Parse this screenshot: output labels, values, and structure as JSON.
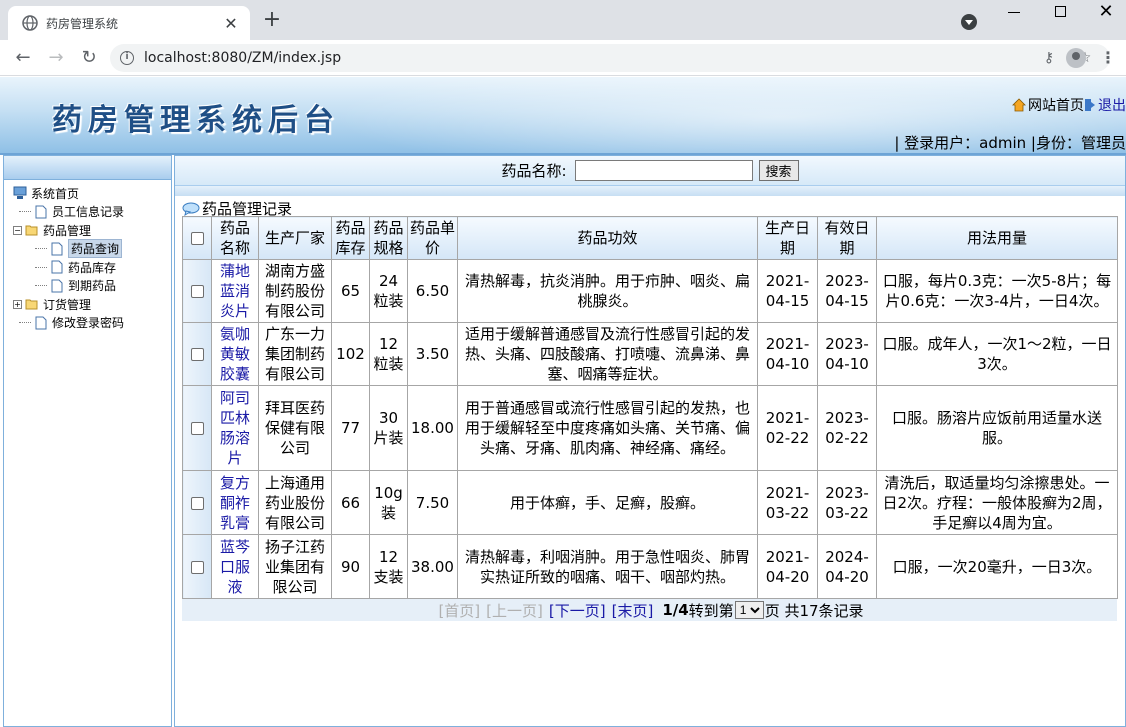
{
  "browser": {
    "tab_title": "药房管理系统",
    "url": "localhost:8080/ZM/index.jsp"
  },
  "header": {
    "title": "药房管理系统后台",
    "home_link": "网站首页",
    "logout_link": "退出",
    "user_line": "| 登录用户：admin    |身份：管理员"
  },
  "sidebar": {
    "items": [
      {
        "label": "系统首页",
        "level": 0,
        "type": "root"
      },
      {
        "label": "员工信息记录",
        "level": 1,
        "type": "leaf"
      },
      {
        "label": "药品管理",
        "level": 0,
        "type": "folder-open"
      },
      {
        "label": "药品查询",
        "level": 1,
        "type": "leaf",
        "selected": true
      },
      {
        "label": "药品库存",
        "level": 1,
        "type": "leaf"
      },
      {
        "label": "到期药品",
        "level": 1,
        "type": "leaf"
      },
      {
        "label": "订货管理",
        "level": 0,
        "type": "folder"
      },
      {
        "label": "修改登录密码",
        "level": 1,
        "type": "leaf"
      }
    ]
  },
  "search": {
    "label": "药品名称:",
    "value": "",
    "button": "搜索"
  },
  "section_title": "药品管理记录",
  "table": {
    "headers": [
      "药品名称",
      "生产厂家",
      "药品库存",
      "药品规格",
      "药品单价",
      "药品功效",
      "生产日期",
      "有效日期",
      "用法用量"
    ],
    "rows": [
      {
        "name": "蒲地蓝消炎片",
        "maker": "湖南方盛制药股份有限公司",
        "stock": "65",
        "spec": "24粒装",
        "price": "6.50",
        "effect": "清热解毒，抗炎消肿。用于疖肿、咽炎、扁桃腺炎。",
        "made": "2021-04-15",
        "expire": "2023-04-15",
        "usage": "口服，每片0.3克：一次5-8片；每片0.6克：一次3-4片，一日4次。"
      },
      {
        "name": "氨咖黄敏胶囊",
        "maker": "广东一力集团制药有限公司",
        "stock": "102",
        "spec": "12粒装",
        "price": "3.50",
        "effect": "适用于缓解普通感冒及流行性感冒引起的发热、头痛、四肢酸痛、打喷嚏、流鼻涕、鼻塞、咽痛等症状。",
        "made": "2021-04-10",
        "expire": "2023-04-10",
        "usage": "口服。成年人，一次1～2粒，一日3次。"
      },
      {
        "name": "阿司匹林肠溶片",
        "maker": "拜耳医药保健有限公司",
        "stock": "77",
        "spec": "30片装",
        "price": "18.00",
        "effect": "用于普通感冒或流行性感冒引起的发热，也用于缓解轻至中度疼痛如头痛、关节痛、偏头痛、牙痛、肌肉痛、神经痛、痛经。",
        "made": "2021-02-22",
        "expire": "2023-02-22",
        "usage": "口服。肠溶片应饭前用适量水送服。"
      },
      {
        "name": "复方酮祚乳膏",
        "maker": "上海通用药业股份有限公司",
        "stock": "66",
        "spec": "10g装",
        "price": "7.50",
        "effect": "用于体癣，手、足癣，股癣。",
        "made": "2021-03-22",
        "expire": "2023-03-22",
        "usage": "清洗后，取适量均匀涂擦患处。一日2次。疗程：一般体股癣为2周，手足癣以4周为宜。"
      },
      {
        "name": "蓝芩口服液",
        "maker": "扬子江药业集团有限公司",
        "stock": "90",
        "spec": "12支装",
        "price": "38.00",
        "effect": "清热解毒，利咽消肿。用于急性咽炎、肺胃实热证所致的咽痛、咽干、咽部灼热。",
        "made": "2021-04-20",
        "expire": "2024-04-20",
        "usage": "口服，一次20毫升，一日3次。"
      }
    ]
  },
  "pager": {
    "first": "[首页]",
    "prev": "[上一页]",
    "next": "[下一页]",
    "last": "[末页]",
    "current": "1/4",
    "goto_prefix": "转到第",
    "goto_value": "1",
    "goto_suffix": "页 共17条记录"
  }
}
